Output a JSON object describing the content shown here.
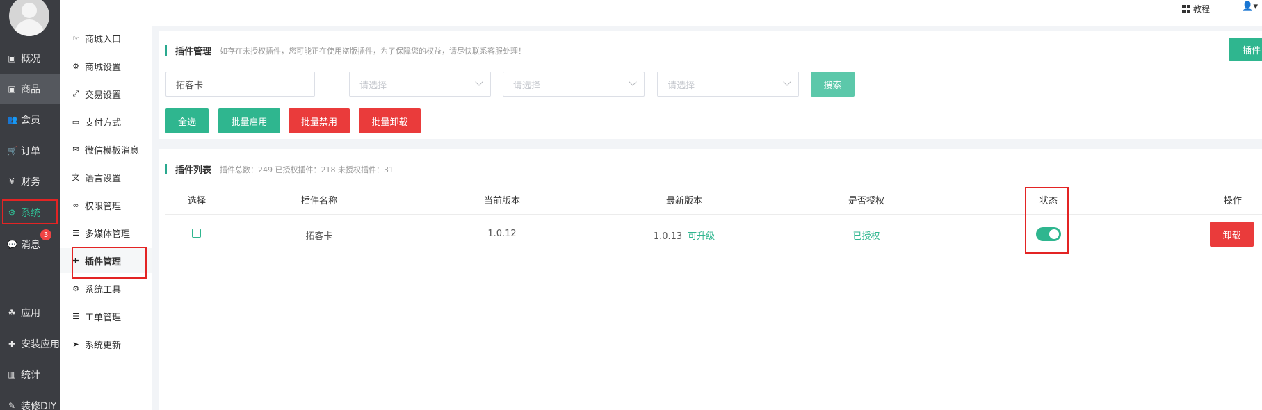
{
  "sidebar": {
    "items": [
      {
        "label": "概况",
        "icon": "archive-icon"
      },
      {
        "label": "商品",
        "icon": "box-icon"
      },
      {
        "label": "会员",
        "icon": "users-icon"
      },
      {
        "label": "订单",
        "icon": "cart-icon"
      },
      {
        "label": "财务",
        "icon": "yen-icon"
      },
      {
        "label": "系统",
        "icon": "cogs-icon"
      },
      {
        "label": "消息",
        "icon": "chat-icon"
      },
      {
        "label": "应用",
        "icon": "apps-icon"
      },
      {
        "label": "安装应用",
        "icon": "puzzle-icon"
      },
      {
        "label": "统计",
        "icon": "bar-chart-icon"
      },
      {
        "label": "装修DIY",
        "icon": "paint-icon"
      }
    ],
    "message_badge": "3"
  },
  "submenu": {
    "items": [
      {
        "label": "商城入口"
      },
      {
        "label": "商城设置"
      },
      {
        "label": "交易设置"
      },
      {
        "label": "支付方式"
      },
      {
        "label": "微信模板消息"
      },
      {
        "label": "语言设置"
      },
      {
        "label": "权限管理"
      },
      {
        "label": "多媒体管理"
      },
      {
        "label": "插件管理"
      },
      {
        "label": "系统工具"
      },
      {
        "label": "工单管理"
      },
      {
        "label": "系统更新"
      }
    ]
  },
  "topbar": {
    "tutorial": "教程",
    "user_icon": "user-icon"
  },
  "plugin_manage": {
    "title": "插件管理",
    "hint": "如存在未授权插件，您可能正在使用盗版插件，为了保障您的权益，请尽快联系客服处理！",
    "top_right_button": "插件",
    "search_value": "拓客卡",
    "select_placeholder_1": "请选择",
    "select_placeholder_2": "请选择",
    "select_placeholder_3": "请选择",
    "search_button": "搜索",
    "select_all": "全选",
    "batch_enable": "批量启用",
    "batch_disable": "批量禁用",
    "batch_uninstall": "批量卸载"
  },
  "plugin_list": {
    "title": "插件列表",
    "summary": "插件总数：249 已授权插件：218 未授权插件：31",
    "headers": {
      "select": "选择",
      "name": "插件名称",
      "current_version": "当前版本",
      "latest_version": "最新版本",
      "authorized": "是否授权",
      "status": "状态",
      "action": "操作"
    },
    "rows": [
      {
        "name": "拓客卡",
        "current_version": "1.0.12",
        "latest_version": "1.0.13",
        "upgrade": "可升级",
        "authorized": "已授权",
        "status_on": true,
        "action": "卸载"
      }
    ]
  },
  "colors": {
    "sidebar_bg": "#3b3d42",
    "accent_green": "#2fb68f",
    "danger_red": "#ea3b3b",
    "highlight_box": "#e32424"
  }
}
